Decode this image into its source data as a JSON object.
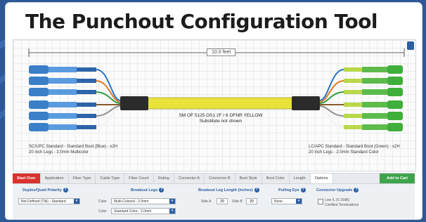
{
  "title": "The Punchout Configuration Tool",
  "diagram": {
    "length_label": "10.0 feet",
    "cable_label_line1": "SM OF 5125 OS1 2F / 6 OFNR YELLOW",
    "cable_label_line2": "Substitute not shown",
    "left_connector_note_line1": "SC/UPC Standard - Standard Boot (Blue) - x2H",
    "left_connector_note_line2": "20 inch Legs - 2.0mm Multicolor",
    "right_connector_note_line1": "LC/APC Standard - Standard Boot (Green) - x2H",
    "right_connector_note_line2": "20 inch Legs - 2.0mm Standard Color",
    "colors": {
      "cable": "#e8e23a",
      "left_boot": "#3a7fc7",
      "right_boot": "#3fae3a",
      "breakout": "#2b2b2b"
    }
  },
  "tabs": [
    {
      "label": "Start Over",
      "kind": "start"
    },
    {
      "label": "Application",
      "kind": "normal"
    },
    {
      "label": "Fiber Type",
      "kind": "normal"
    },
    {
      "label": "Cable Type",
      "kind": "normal"
    },
    {
      "label": "Fiber Count",
      "kind": "normal"
    },
    {
      "label": "Rating",
      "kind": "normal"
    },
    {
      "label": "Connector A",
      "kind": "normal"
    },
    {
      "label": "Connector B",
      "kind": "normal"
    },
    {
      "label": "Boot Style",
      "kind": "normal"
    },
    {
      "label": "Boot Color",
      "kind": "normal"
    },
    {
      "label": "Length",
      "kind": "normal"
    },
    {
      "label": "Options",
      "kind": "active"
    },
    {
      "label": "Add to Cart",
      "kind": "add"
    }
  ],
  "options": {
    "polarity_title": "Duplex/Quad Polarity",
    "polarity_value": "Not Defined (TIA) - Standard",
    "breakout_title": "Breakout Legs",
    "breakout_a_label": "Color",
    "breakout_a_value": "Multi-Colored - 2.0mm",
    "breakout_b_label": "Color",
    "breakout_b_value": "Standard Color - 2.0mm",
    "legs_title": "Breakout Leg Length (inches)",
    "legs_a_label": "Side A",
    "legs_a_value": "20",
    "legs_b_label": "Side B",
    "legs_b_value": "20",
    "pulling_title": "Pulling Eye",
    "pulling_value": "None",
    "upgrade_title": "Connector Upgrade",
    "upgrade_line1": "Low IL (0.15dB)",
    "upgrade_line2": "Certified Terminations"
  }
}
